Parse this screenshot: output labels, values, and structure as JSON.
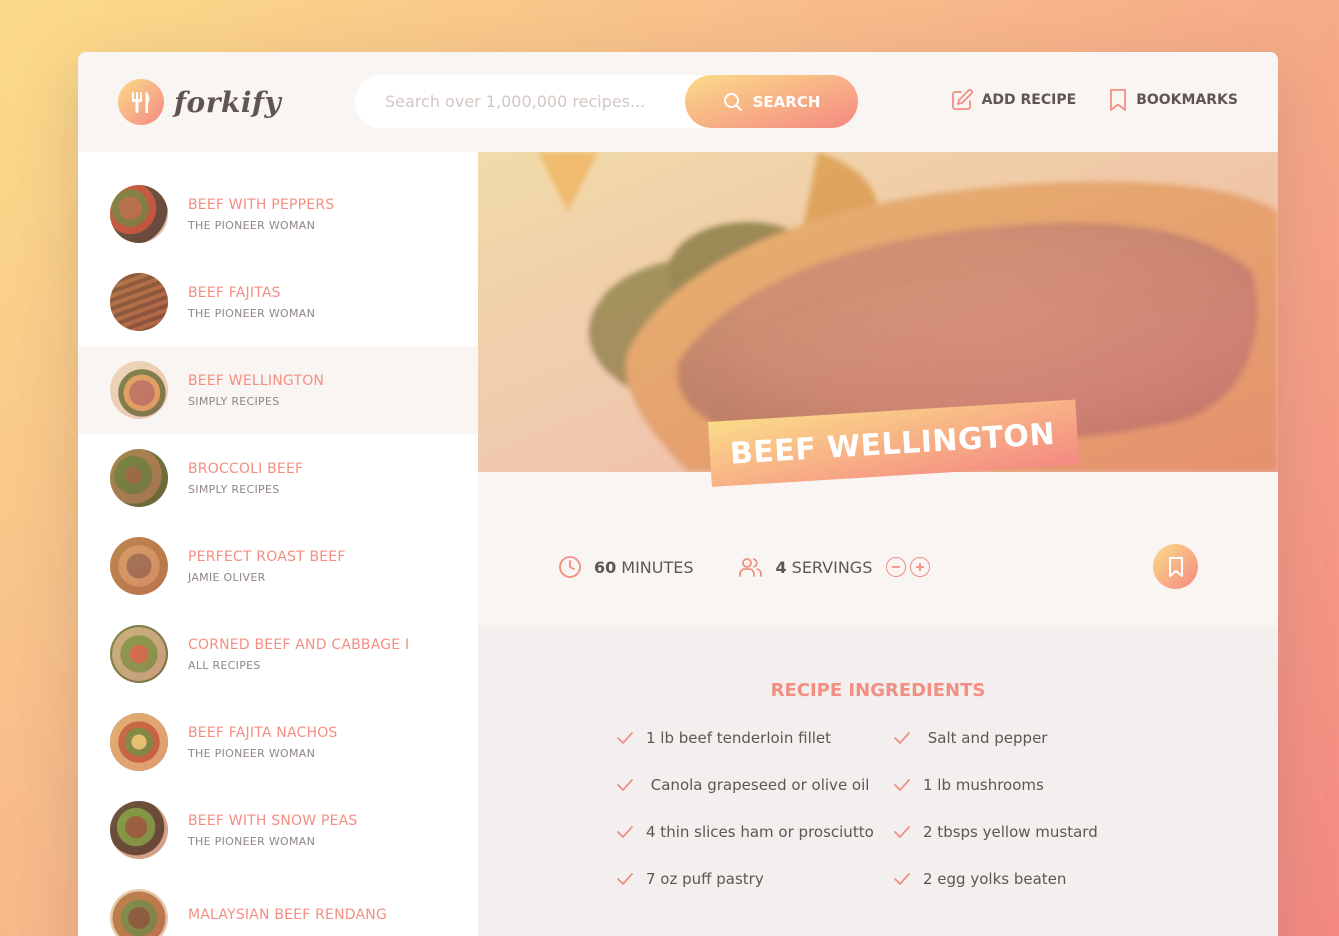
{
  "header": {
    "logo_text": "forkify",
    "search_placeholder": "Search over 1,000,000 recipes...",
    "search_label": "SEARCH",
    "nav": [
      {
        "label": "ADD RECIPE",
        "icon": "edit-icon"
      },
      {
        "label": "BOOKMARKS",
        "icon": "bookmark-icon"
      }
    ]
  },
  "results": [
    {
      "title": "BEEF WITH PEPPERS",
      "publisher": "THE PIONEER WOMAN"
    },
    {
      "title": "BEEF FAJITAS",
      "publisher": "THE PIONEER WOMAN"
    },
    {
      "title": "BEEF WELLINGTON",
      "publisher": "SIMPLY RECIPES"
    },
    {
      "title": "BROCCOLI BEEF",
      "publisher": "SIMPLY RECIPES"
    },
    {
      "title": "PERFECT ROAST BEEF",
      "publisher": "JAMIE OLIVER"
    },
    {
      "title": "CORNED BEEF AND CABBAGE I",
      "publisher": "ALL RECIPES"
    },
    {
      "title": "BEEF FAJITA NACHOS",
      "publisher": "THE PIONEER WOMAN"
    },
    {
      "title": "BEEF WITH SNOW PEAS",
      "publisher": "THE PIONEER WOMAN"
    },
    {
      "title": "MALAYSIAN BEEF RENDANG",
      "publisher": ""
    }
  ],
  "recipe": {
    "title": "BEEF WELLINGTON",
    "minutes": "60",
    "minutes_unit": "MINUTES",
    "servings": "4",
    "servings_unit": "SERVINGS",
    "ingredients_heading": "RECIPE INGREDIENTS",
    "ingredients": [
      "1 lb beef tenderloin fillet",
      " Salt and pepper",
      " Canola grapeseed or olive oil",
      "1 lb mushrooms",
      "4 thin slices ham or prosciutto",
      "2 tbsps yellow mustard",
      "7 oz puff pastry",
      "2 egg yolks beaten"
    ]
  },
  "colors": {
    "accent": "#f38e82",
    "gradient_start": "#fbdb89",
    "gradient_end": "#f48982",
    "text": "#615551"
  }
}
